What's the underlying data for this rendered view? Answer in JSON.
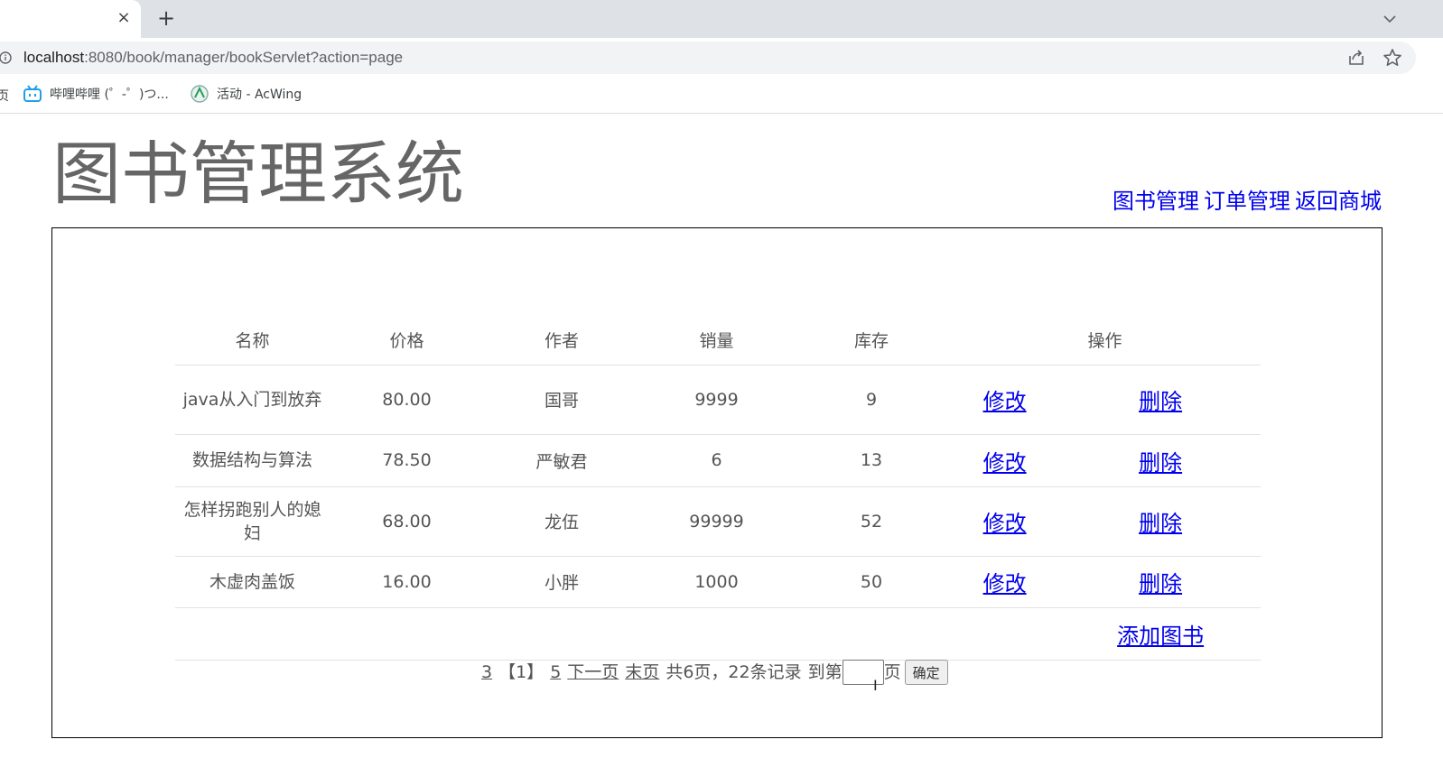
{
  "browser": {
    "tab_close": "×",
    "new_tab": "+",
    "url_host": "localhost",
    "url_rest": ":8080/book/manager/bookServlet?action=page",
    "bookmark_cut": "页",
    "bookmarks": [
      {
        "label": "哔哩哔哩 (゜-゜)つ...",
        "icon": "bilibili-icon"
      },
      {
        "label": "活动 - AcWing",
        "icon": "acwing-icon"
      }
    ]
  },
  "header": {
    "title": "图书管理系统",
    "nav": [
      "图书管理",
      "订单管理",
      "返回商城"
    ]
  },
  "table": {
    "columns": [
      "名称",
      "价格",
      "作者",
      "销量",
      "库存",
      "操作"
    ],
    "rows": [
      {
        "name": "java从入门到放弃",
        "price": "80.00",
        "author": "国哥",
        "sales": "9999",
        "stock": "9",
        "edit": "修改",
        "delete": "删除"
      },
      {
        "name": "数据结构与算法",
        "price": "78.50",
        "author": "严敏君",
        "sales": "6",
        "stock": "13",
        "edit": "修改",
        "delete": "删除"
      },
      {
        "name": "怎样拐跑别人的媳妇",
        "price": "68.00",
        "author": "龙伍",
        "sales": "99999",
        "stock": "52",
        "edit": "修改",
        "delete": "删除"
      },
      {
        "name": "木虚肉盖饭",
        "price": "16.00",
        "author": "小胖",
        "sales": "1000",
        "stock": "50",
        "edit": "修改",
        "delete": "删除"
      }
    ],
    "add_label": "添加图书"
  },
  "pager": {
    "prev_page": "3",
    "current_page": "【1】",
    "next_page_num": "5",
    "next_label": "下一页",
    "last_label": "末页",
    "summary": "共6页，22条记录",
    "goto_prefix": "到第",
    "goto_suffix": "页",
    "goto_value": "",
    "confirm_label": "确定"
  },
  "colors": {
    "link": "#0000ee",
    "text": "#555555",
    "chrome_tabstrip": "#dee1e6"
  }
}
